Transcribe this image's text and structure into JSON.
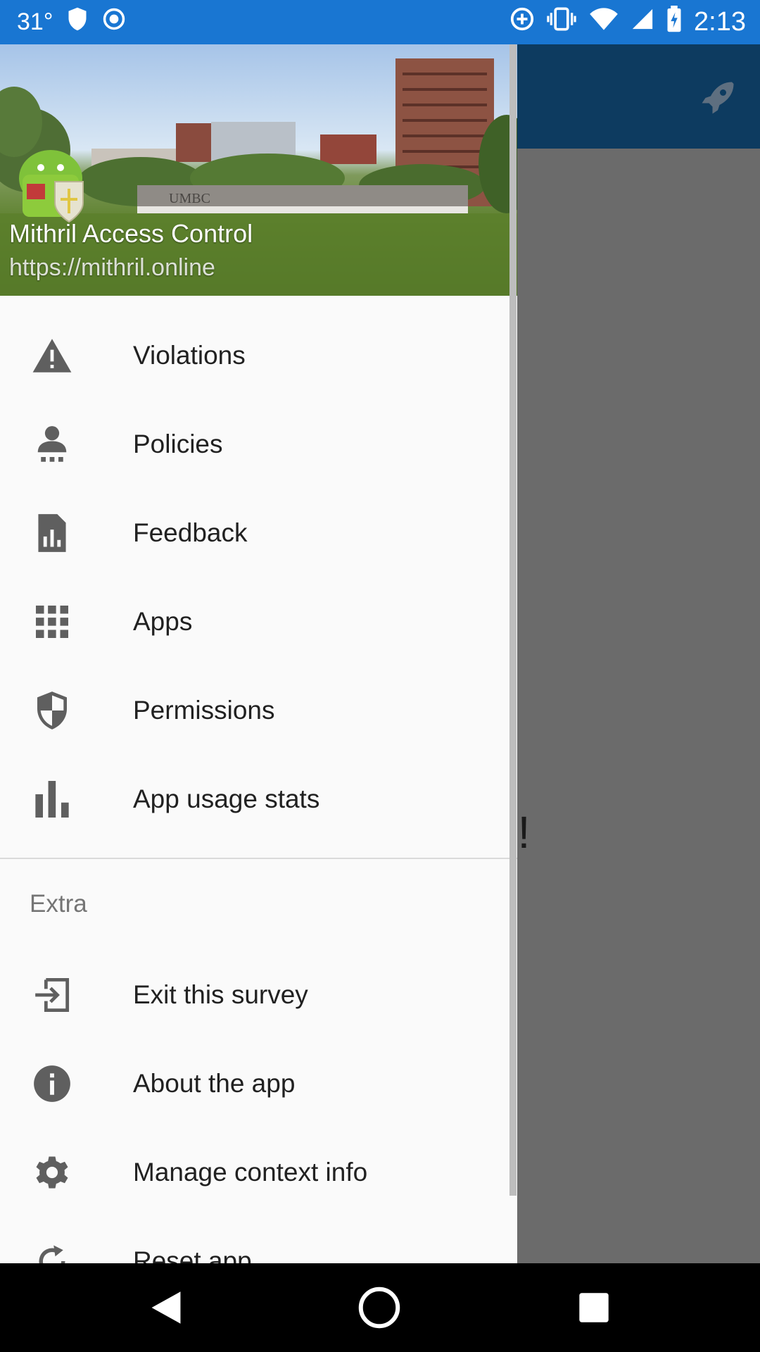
{
  "status_bar": {
    "temperature": "31°",
    "time": "2:13"
  },
  "header": {
    "title": "Mithril Access Control",
    "subtitle": "https://mithril.online",
    "campus_sign": "UMBC"
  },
  "menu": {
    "items": [
      {
        "label": "Violations",
        "icon": "warning-icon"
      },
      {
        "label": "Policies",
        "icon": "person-icon"
      },
      {
        "label": "Feedback",
        "icon": "document-chart-icon"
      },
      {
        "label": "Apps",
        "icon": "apps-grid-icon"
      },
      {
        "label": "Permissions",
        "icon": "shield-icon"
      },
      {
        "label": "App usage stats",
        "icon": "bar-chart-icon"
      }
    ],
    "section_title": "Extra",
    "extra_items": [
      {
        "label": "Exit this survey",
        "icon": "exit-icon"
      },
      {
        "label": "About the app",
        "icon": "info-icon"
      },
      {
        "label": "Manage context info",
        "icon": "gear-icon"
      },
      {
        "label": "Reset app",
        "icon": "reset-icon"
      }
    ]
  },
  "background_text": "e!",
  "colors": {
    "status_bar": "#1976d2",
    "app_bar": "#0d3b60",
    "drawer": "#fafafa",
    "scrim": "#6b6b6b"
  }
}
